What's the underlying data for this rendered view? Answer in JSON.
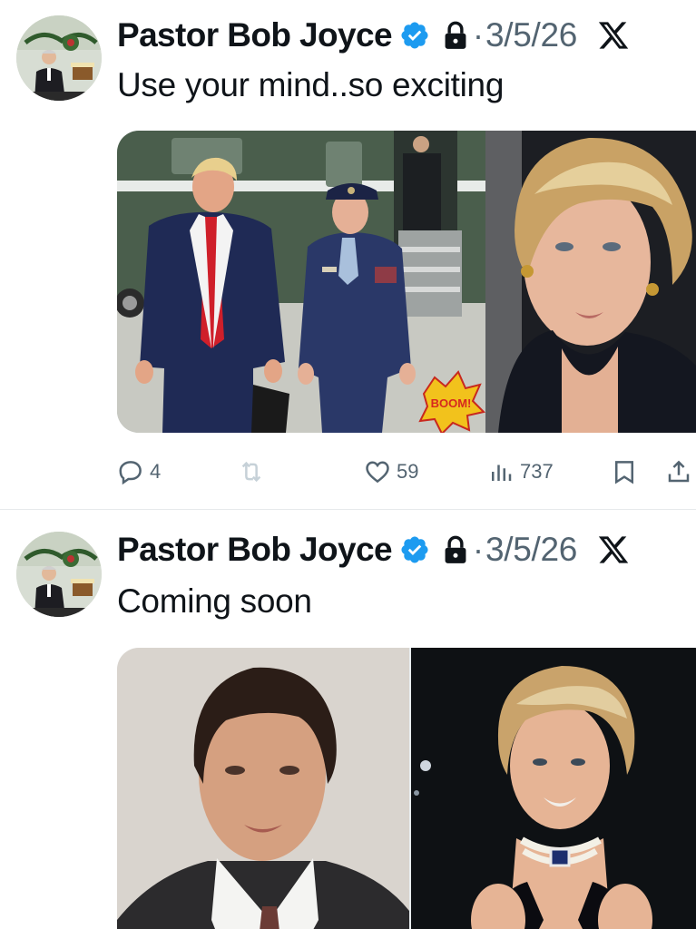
{
  "tweets": [
    {
      "author": "Pastor Bob Joyce",
      "date": "3/5/26",
      "separator": "·",
      "text": "Use your mind..so exciting",
      "media_sticker": "BOOM!",
      "actions": {
        "replies": "4",
        "retweets": "",
        "likes": "59",
        "views": "737"
      }
    },
    {
      "author": "Pastor Bob Joyce",
      "date": "3/5/26",
      "separator": "·",
      "text": "Coming soon"
    }
  ],
  "icons": {
    "verified": "verified-badge-icon",
    "lock": "lock-icon",
    "x_logo": "x-logo-icon",
    "reply": "reply-icon",
    "retweet": "retweet-icon",
    "like": "heart-icon",
    "views": "views-icon",
    "bookmark": "bookmark-icon",
    "share": "share-icon"
  },
  "colors": {
    "verified_blue": "#1d9bf0",
    "secondary_text": "#536471",
    "primary_text": "#0f1419",
    "divider": "#e6e9ec"
  }
}
